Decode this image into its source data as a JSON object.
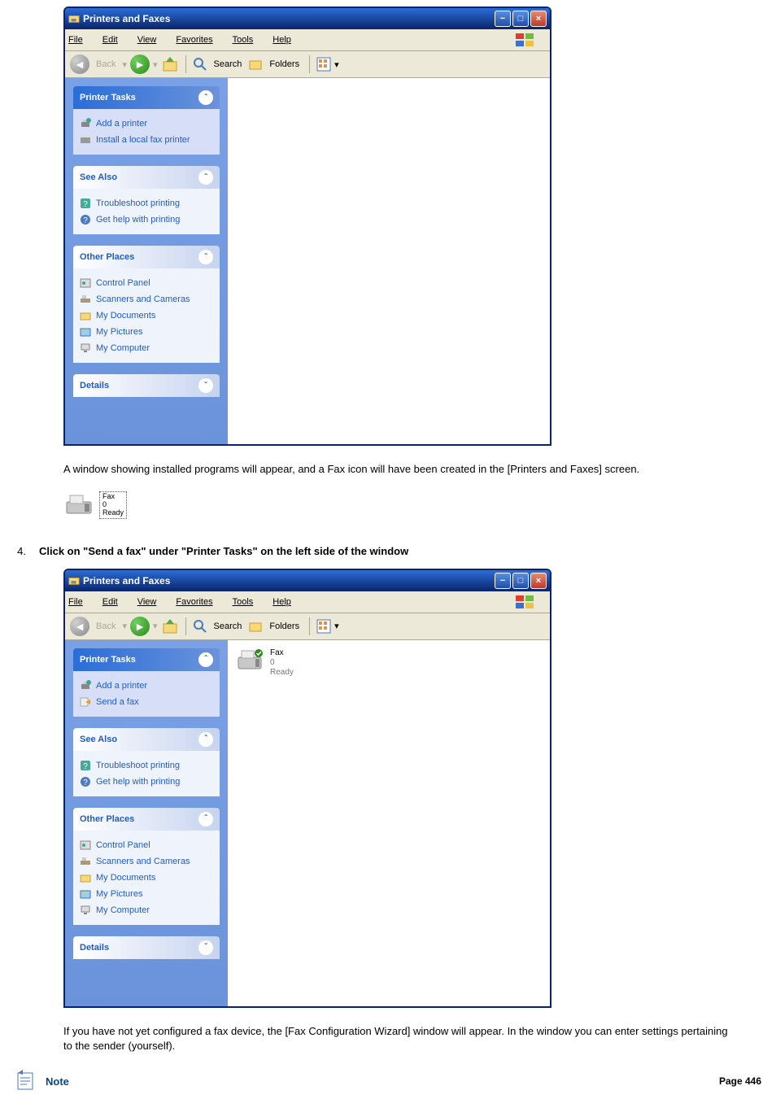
{
  "window1": {
    "title": "Printers and Faxes",
    "menu": {
      "file": "File",
      "edit": "Edit",
      "view": "View",
      "favorites": "Favorites",
      "tools": "Tools",
      "help": "Help"
    },
    "toolbar": {
      "back": "Back",
      "search": "Search",
      "folders": "Folders"
    },
    "sidebar": {
      "printerTasks": {
        "header": "Printer Tasks",
        "addPrinter": "Add a printer",
        "installFax": "Install a local fax printer"
      },
      "seeAlso": {
        "header": "See Also",
        "troubleshoot": "Troubleshoot printing",
        "getHelp": "Get help with printing"
      },
      "otherPlaces": {
        "header": "Other Places",
        "controlPanel": "Control Panel",
        "scanners": "Scanners and Cameras",
        "myDocs": "My Documents",
        "myPics": "My Pictures",
        "myComp": "My Computer"
      },
      "details": {
        "header": "Details"
      }
    }
  },
  "para1": "A window showing installed programs will appear, and a Fax icon will have been created in the [Printers and Faxes] screen.",
  "faxSmall": {
    "name": "Fax",
    "count": "0",
    "status": "Ready"
  },
  "step4": {
    "num": "4.",
    "text": "Click on \"Send a fax\" under \"Printer Tasks\" on the left side of the window"
  },
  "window2": {
    "title": "Printers and Faxes",
    "menu": {
      "file": "File",
      "edit": "Edit",
      "view": "View",
      "favorites": "Favorites",
      "tools": "Tools",
      "help": "Help"
    },
    "toolbar": {
      "back": "Back",
      "search": "Search",
      "folders": "Folders"
    },
    "sidebar": {
      "printerTasks": {
        "header": "Printer Tasks",
        "addPrinter": "Add a printer",
        "sendFax": "Send a fax"
      },
      "seeAlso": {
        "header": "See Also",
        "troubleshoot": "Troubleshoot printing",
        "getHelp": "Get help with printing"
      },
      "otherPlaces": {
        "header": "Other Places",
        "controlPanel": "Control Panel",
        "scanners": "Scanners and Cameras",
        "myDocs": "My Documents",
        "myPics": "My Pictures",
        "myComp": "My Computer"
      },
      "details": {
        "header": "Details"
      }
    },
    "faxItem": {
      "name": "Fax",
      "count": "0",
      "status": "Ready"
    }
  },
  "para2": "If you have not yet configured a fax device, the [Fax Configuration Wizard] window will appear. In the window you can enter settings pertaining to the sender (yourself).",
  "footer": {
    "note": "Note",
    "page": "Page 446"
  }
}
